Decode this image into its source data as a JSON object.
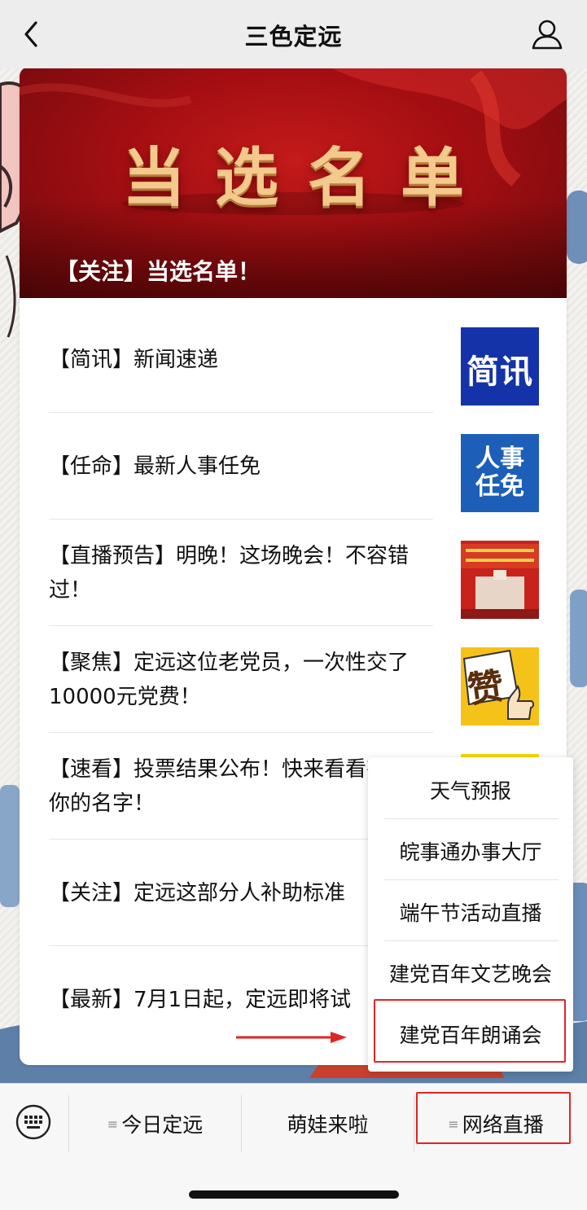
{
  "nav": {
    "title": "三色定远"
  },
  "banner": {
    "heading": "当选名单",
    "title": "【关注】当选名单！"
  },
  "articles": [
    {
      "title": "【简讯】新闻速递",
      "thumb_text": "简讯"
    },
    {
      "title": "【任命】最新人事任免",
      "thumb_text": "人事任免"
    },
    {
      "title": "【直播预告】明晚！这场晚会！不容错过！",
      "thumb_text": ""
    },
    {
      "title": "【聚焦】定远这位老党员，一次性交了10000元党费！",
      "thumb_text": "赞"
    },
    {
      "title": "【速看】投票结果公布！快来看看有没有你的名字！",
      "thumb_text": ""
    },
    {
      "title": "【关注】定远这部分人补助标准",
      "thumb_text": ""
    },
    {
      "title": "【最新】7月1日起，定远即将试",
      "thumb_text": ""
    }
  ],
  "popup_menu": {
    "items": [
      "天气预报",
      "皖事通办事大厅",
      "端午节活动直播",
      "建党百年文艺晚会",
      "建党百年朗诵会"
    ],
    "highlighted_index": 4
  },
  "bottom_menu": {
    "items": [
      {
        "label": "今日定远",
        "has_submenu": true
      },
      {
        "label": "萌娃来啦",
        "has_submenu": false
      },
      {
        "label": "网络直播",
        "has_submenu": true
      }
    ],
    "submenu_glyph": "≡"
  },
  "colors": {
    "highlight": "#e02424",
    "banner_red": "#a30e12",
    "thumb_blue": "#1533a8"
  }
}
